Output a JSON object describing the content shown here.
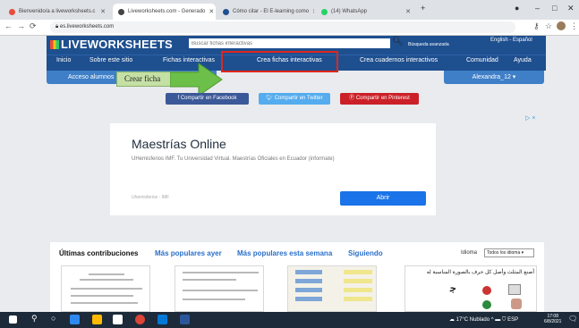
{
  "browser": {
    "tabs": [
      {
        "label": "Bienvenido/a a liveworksheets.c",
        "favicon_color": "#e74c3c"
      },
      {
        "label": "Liveworksheets.com - Generado",
        "favicon_color": "#444444"
      },
      {
        "label": "Cómo citar - El E-learning como",
        "favicon_color": "#1e4f8f"
      },
      {
        "label": "(14) WhatsApp",
        "favicon_color": "#25d366"
      }
    ],
    "new_tab": "+",
    "url": "es.liveworksheets.com",
    "window_controls": {
      "minimize": "–",
      "maximize": "□",
      "close": "✕"
    }
  },
  "site": {
    "logo": "LIVEWORKSHEETS",
    "search_placeholder": "Buscar fichas interactivas",
    "advanced_search": "Búsqueda avanzada",
    "language": "English - Español",
    "nav": [
      "Inicio",
      "Sobre este sitio",
      "Fichas interactivas",
      "Crea fichas interactivas",
      "Crea cuadernos interactivos",
      "Comunidad",
      "Ayuda"
    ],
    "access_button": "Acceso alumnos",
    "user_button": "Alexandra_12 ▾",
    "tooltip": "Crear ficha",
    "share": {
      "facebook": "f  Compartir en Facebook",
      "twitter": "Compartir en Twitter",
      "pinterest": "Compartir en Pinterest"
    }
  },
  "ad": {
    "title": "Maestrías Online",
    "description": "UHemisferios IMF. Tu Universidad Virtual. Maestrías Oficiales en Ecuador (informate)",
    "sponsor": "Uhemisferios - IMF",
    "button": "Abrir",
    "choices": "▷ ×"
  },
  "contributions": {
    "tabs": [
      "Últimas contribuciones",
      "Más populares ayer",
      "Más populares esta semana",
      "Siguiendo"
    ],
    "idioma_label": "Idioma",
    "idioma_value": "Todos los idioma ▾",
    "thumb4_text": "أصنع المثلث وأصل كل حرف بالصورة المناسبة له"
  },
  "taskbar": {
    "weather": "17°C  Nublado",
    "lang": "ESP",
    "time": "17:08",
    "date": "6/8/2021"
  },
  "colors": {
    "site_blue": "#1e4f8f",
    "accent_blue": "#3f7fc7",
    "highlight_red": "#e0261c",
    "arrow_green": "#6cc04a"
  }
}
